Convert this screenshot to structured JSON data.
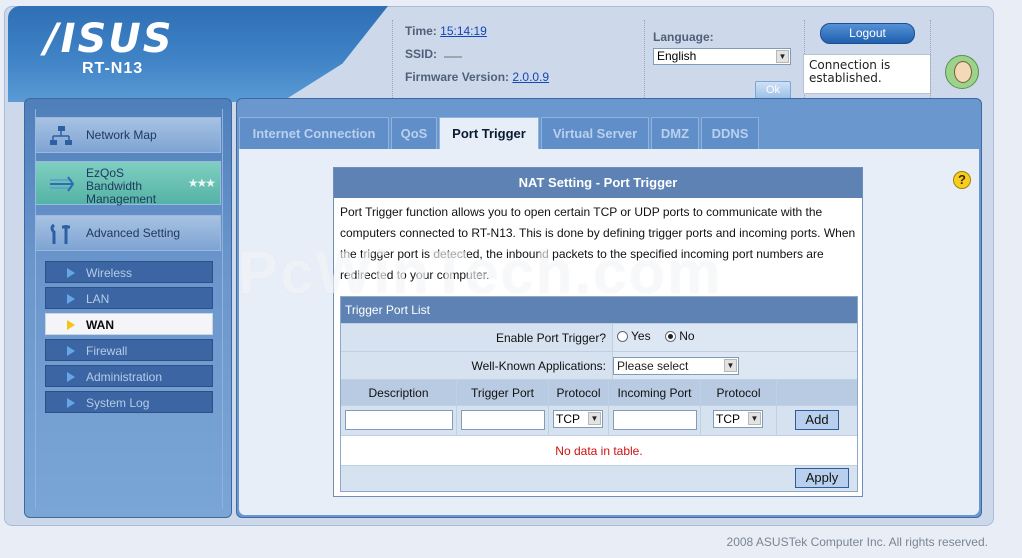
{
  "header": {
    "brand": "/ISUS",
    "model": "RT-N13",
    "time_label": "Time:",
    "time_value": "15:14:19",
    "ssid_label": "SSID:",
    "firmware_label": "Firmware Version:",
    "firmware_value": "2.0.0.9",
    "language_label": "Language:",
    "language_value": "English",
    "ok_label": "Ok",
    "logout_label": "Logout",
    "connection_status": "Connection is established."
  },
  "sidebar": {
    "menu": [
      {
        "label": "Network Map",
        "icon": "network-map-icon"
      },
      {
        "label": "EzQoS Bandwidth Management",
        "icon": "qos-icon"
      },
      {
        "label": "Advanced Setting",
        "icon": "tools-icon"
      }
    ],
    "submenu": [
      {
        "label": "Wireless"
      },
      {
        "label": "LAN"
      },
      {
        "label": "WAN",
        "active": true
      },
      {
        "label": "Firewall"
      },
      {
        "label": "Administration"
      },
      {
        "label": "System Log"
      }
    ]
  },
  "tabs": [
    {
      "label": "Internet Connection"
    },
    {
      "label": "QoS"
    },
    {
      "label": "Port Trigger",
      "active": true
    },
    {
      "label": "Virtual Server"
    },
    {
      "label": "DMZ"
    },
    {
      "label": "DDNS"
    }
  ],
  "nat": {
    "title": "NAT Setting - Port Trigger",
    "description": "Port Trigger function allows you to open certain TCP or UDP ports to communicate with the computers connected to RT-N13. This is done by defining trigger ports and incoming ports. When the trigger port is detected, the inbound packets to the specified incoming port numbers are redirected to your computer.",
    "watermark": "PcWinTech.com",
    "list_title": "Trigger Port List",
    "enable_label": "Enable Port Trigger?",
    "yes_label": "Yes",
    "no_label": "No",
    "apps_label": "Well-Known Applications:",
    "apps_placeholder": "Please select",
    "columns": [
      "Description",
      "Trigger Port",
      "Protocol",
      "Incoming Port",
      "Protocol"
    ],
    "protocol_value_1": "TCP",
    "protocol_value_2": "TCP",
    "add_label": "Add",
    "empty_message": "No data in table.",
    "apply_label": "Apply"
  },
  "footer": {
    "copyright": "2008 ASUSTek Computer Inc. All rights reserved."
  }
}
